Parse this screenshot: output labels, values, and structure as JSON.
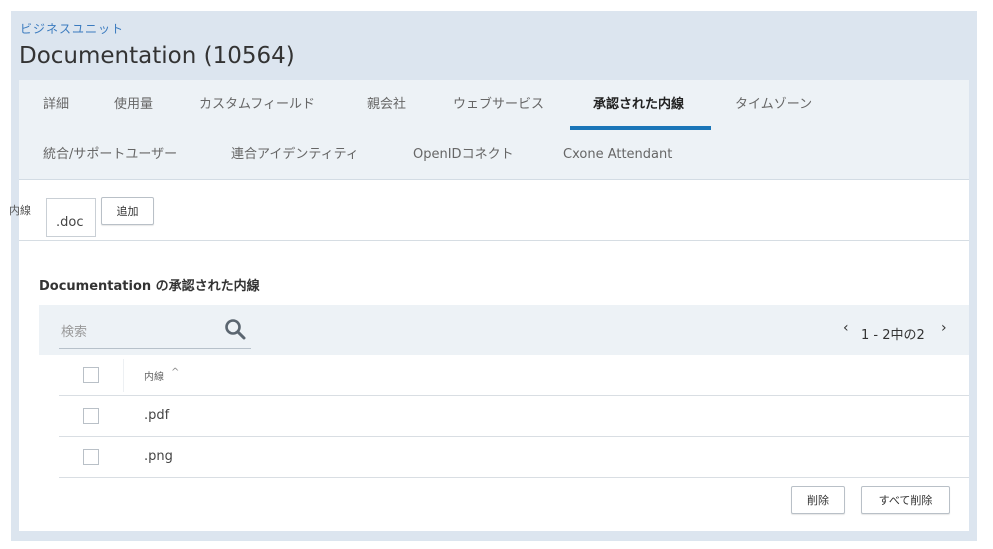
{
  "header": {
    "breadcrumb": "ビジネスユニット",
    "title": "Documentation (10564)"
  },
  "tabs": [
    {
      "label": "詳細"
    },
    {
      "label": "使用量"
    },
    {
      "label": "カスタムフィールド"
    },
    {
      "label": "親会社"
    },
    {
      "label": "ウェブサービス"
    },
    {
      "label": "承認された内線",
      "active": true
    },
    {
      "label": "タイムゾーン"
    },
    {
      "label": "統合/サポートユーザー"
    },
    {
      "label": "連合アイデンティティ"
    },
    {
      "label": "OpenIDコネクト"
    },
    {
      "label": "Cxone Attendant"
    }
  ],
  "extension_form": {
    "label": "内線",
    "value": ".doc",
    "add_label": "追加"
  },
  "section_title": "Documentation の承認された内線",
  "search": {
    "placeholder": "検索",
    "icon": "search-icon"
  },
  "pager": {
    "text": "1 - 2中の2",
    "prev": "‹",
    "next": "›"
  },
  "table": {
    "header_label": "内線",
    "sort_indicator": "^",
    "rows": [
      {
        "value": ".pdf"
      },
      {
        "value": ".png"
      }
    ]
  },
  "actions": {
    "delete_label": "削除",
    "delete_all_label": "すべて削除"
  },
  "colors": {
    "accent": "#1a75b8",
    "frame_background": "#dce5ef",
    "tab_background": "#edf2f6"
  }
}
